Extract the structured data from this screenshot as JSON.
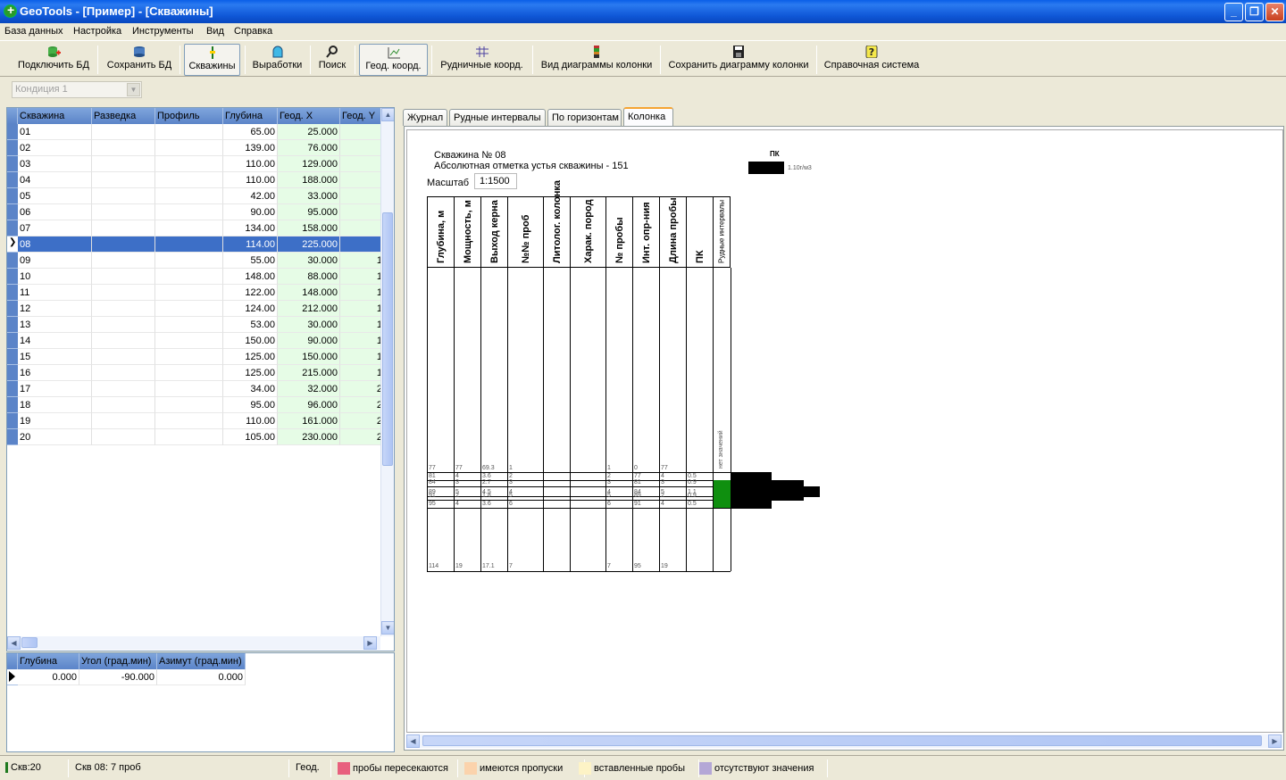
{
  "window": {
    "title": "GeoTools - [Пример] - [Скважины]"
  },
  "menu": [
    "База данных",
    "Настройка",
    "Инструменты",
    "Вид",
    "Справка"
  ],
  "toolbar": {
    "connect_db": "Подключить БД",
    "save_db": "Сохранить БД",
    "wells": "Скважины",
    "workings": "Выработки",
    "search": "Поиск",
    "geo_coords": "Геод. коорд.",
    "mine_coords": "Рудничные коорд.",
    "column_view": "Вид диаграммы колонки",
    "save_column": "Сохранить диаграмму колонки",
    "help": "Справочная система"
  },
  "condition": {
    "value": "Кондиция 1"
  },
  "wells_grid": {
    "headers": [
      "Скважина",
      "Разведка",
      "Профиль",
      "Глубина",
      "Геод. X",
      "Геод. Y"
    ],
    "selected_index": 7,
    "rows": [
      [
        "01",
        "",
        "",
        "65.00",
        "25.000",
        ""
      ],
      [
        "02",
        "",
        "",
        "139.00",
        "76.000",
        ""
      ],
      [
        "03",
        "",
        "",
        "110.00",
        "129.000",
        ""
      ],
      [
        "04",
        "",
        "",
        "110.00",
        "188.000",
        ""
      ],
      [
        "05",
        "",
        "",
        "42.00",
        "33.000",
        ""
      ],
      [
        "06",
        "",
        "",
        "90.00",
        "95.000",
        ""
      ],
      [
        "07",
        "",
        "",
        "134.00",
        "158.000",
        ""
      ],
      [
        "08",
        "",
        "",
        "114.00",
        "225.000",
        ""
      ],
      [
        "09",
        "",
        "",
        "55.00",
        "30.000",
        "1"
      ],
      [
        "10",
        "",
        "",
        "148.00",
        "88.000",
        "1"
      ],
      [
        "11",
        "",
        "",
        "122.00",
        "148.000",
        "1"
      ],
      [
        "12",
        "",
        "",
        "124.00",
        "212.000",
        "1"
      ],
      [
        "13",
        "",
        "",
        "53.00",
        "30.000",
        "1"
      ],
      [
        "14",
        "",
        "",
        "150.00",
        "90.000",
        "1"
      ],
      [
        "15",
        "",
        "",
        "125.00",
        "150.000",
        "1"
      ],
      [
        "16",
        "",
        "",
        "125.00",
        "215.000",
        "1"
      ],
      [
        "17",
        "",
        "",
        "34.00",
        "32.000",
        "2"
      ],
      [
        "18",
        "",
        "",
        "95.00",
        "96.000",
        "2"
      ],
      [
        "19",
        "",
        "",
        "110.00",
        "161.000",
        "2"
      ],
      [
        "20",
        "",
        "",
        "105.00",
        "230.000",
        "2"
      ]
    ]
  },
  "incl_grid": {
    "headers": [
      "Глубина",
      "Угол (град.мин)",
      "Азимут (град.мин)"
    ],
    "rows": [
      [
        "0.000",
        "-90.000",
        "0.000"
      ]
    ]
  },
  "tabs": [
    "Журнал",
    "Рудные интервалы",
    "По горизонтам",
    "Колонка"
  ],
  "column_diagram": {
    "well_title": "Скважина № 08",
    "collar_elevation": "Абсолютная отметка устья скважины - 151",
    "scale_label": "Масштаб",
    "scale_value": "1:1500",
    "legend_pk": "ПК",
    "legend_value": "1.10г/м3",
    "columns": [
      "Глубина, м",
      "Мощность, м",
      "Выход керна",
      "№№ проб",
      "Литолог. колонка",
      "Харак. пород",
      "№ пробы",
      "Инт. опр-ния",
      "Длина пробы",
      "ПК",
      "Рудные интервалы"
    ],
    "no_values_label": "нет значений",
    "rows": [
      [
        "77",
        "77",
        "69.3",
        "1",
        "",
        "",
        "1",
        "0",
        "77",
        "",
        ""
      ],
      [
        "81",
        "4",
        "3.6",
        "2",
        "",
        "",
        "2",
        "77",
        "4",
        "0.5",
        ""
      ],
      [
        "84",
        "3",
        "2.7",
        "3",
        "",
        "",
        "3",
        "81",
        "3",
        "0.9",
        ""
      ],
      [
        "89",
        "5",
        "4.5",
        "4",
        "",
        "",
        "4",
        "84",
        "5",
        "1.1",
        ""
      ],
      [
        "91",
        "2",
        "1.8",
        "5",
        "",
        "",
        "5",
        "89",
        "2",
        "0.9",
        ""
      ],
      [
        "95",
        "4",
        "3.6",
        "6",
        "",
        "",
        "6",
        "91",
        "4",
        "0.5",
        ""
      ],
      [
        "114",
        "19",
        "17.1",
        "7",
        "",
        "",
        "7",
        "95",
        "19",
        "",
        ""
      ]
    ],
    "pk_values": [
      0.5,
      0.9,
      1.1,
      0.9,
      0.5
    ]
  },
  "status": {
    "wells_count": "Скв:20",
    "current": "Скв 08: 7 проб",
    "coord_mode": "Геод.",
    "legend": [
      {
        "label": "пробы пересекаются",
        "color": "#e8607e"
      },
      {
        "label": "имеются пропуски",
        "color": "#fbd3ac"
      },
      {
        "label": "вставленные пробы",
        "color": "#fdf3c6"
      },
      {
        "label": "отсутствуют значения",
        "color": "#b4a7d6"
      }
    ]
  }
}
